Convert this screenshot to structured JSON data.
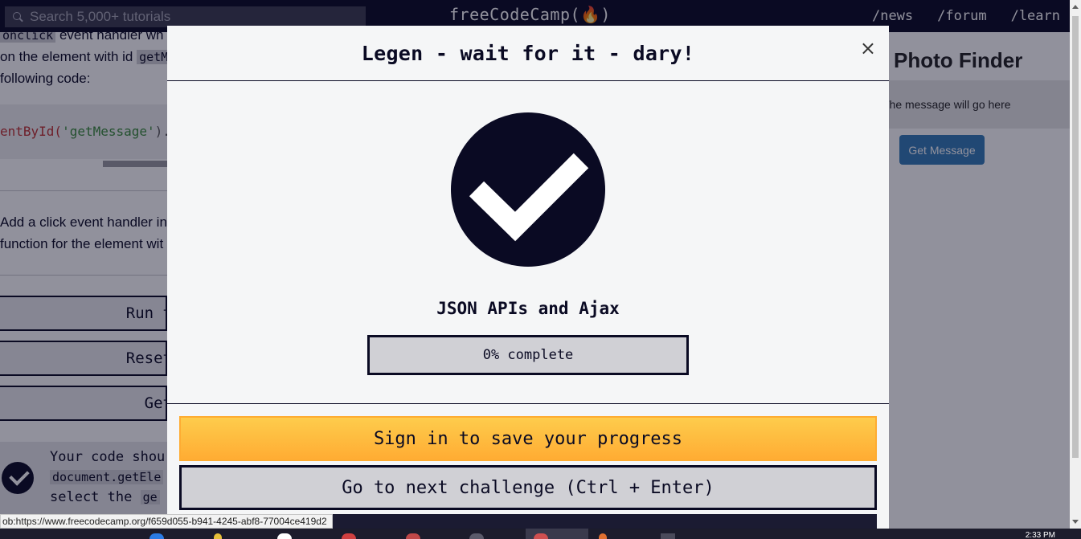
{
  "nav": {
    "search_placeholder": "Search 5,000+ tutorials",
    "brand": "freeCodeCamp(🔥)",
    "links": [
      "/news",
      "/forum",
      "/learn"
    ]
  },
  "background_left": {
    "line1_code": "onclick",
    "line1_rest": "event handler wh",
    "line2_pre": "on the element with id",
    "line2_code": "getM",
    "line3": "following code:",
    "code_fn": "entById(",
    "code_str": "'getMessage'",
    "code_tail": ").",
    "instr1": "Add a click event handler in",
    "instr2": "function for the element wit",
    "buttons": [
      "Run t",
      "Reset",
      "Get"
    ],
    "test_line1": "Your code shou",
    "test_line2": "document.getEle",
    "test_line3_pre": "select the",
    "test_line3_code": "ge"
  },
  "background_right": {
    "heading": "Photo Finder",
    "message": "The message will go here",
    "button": "Get Message"
  },
  "modal": {
    "title": "Legen - wait for it - dary!",
    "close": "×",
    "certification": "JSON APIs and Ajax",
    "progress_percent": 0,
    "progress_label": "0% complete",
    "signin_button": "Sign in to save your progress",
    "next_button": "Go to next challenge (Ctrl + Enter)"
  },
  "status_url": "ob:https://www.freecodecamp.org/f659d055-b941-4245-abf8-77004ce419d2",
  "taskbar": {
    "clock": "2:33 PM"
  },
  "colors": {
    "nav_bg": "#0a0a23",
    "signin_yellow": "#feac32",
    "check_circle": "#0a0a23",
    "progress_bg": "#d0d0d5",
    "link_blue": "#337ab7"
  }
}
